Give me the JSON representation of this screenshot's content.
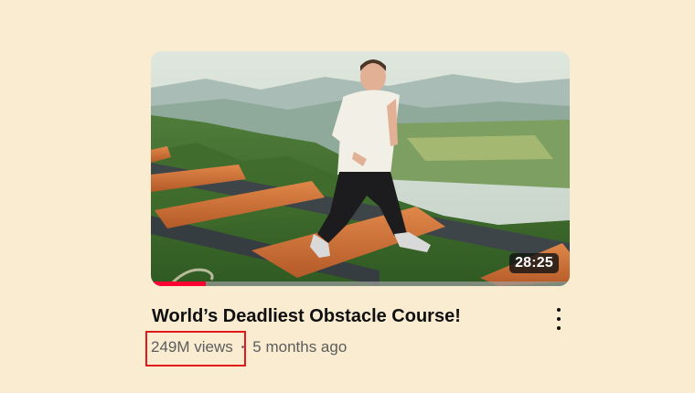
{
  "video": {
    "title": "World’s Deadliest Obstacle Course!",
    "views": "249M views",
    "separator": "•",
    "age": "5 months ago",
    "duration": "28:25",
    "watch_progress": 0.13
  },
  "icons": {
    "more": "more-vert-icon"
  },
  "colors": {
    "background": "#f9ecd1",
    "progress": "#ff0033",
    "highlight": "#e01919"
  }
}
